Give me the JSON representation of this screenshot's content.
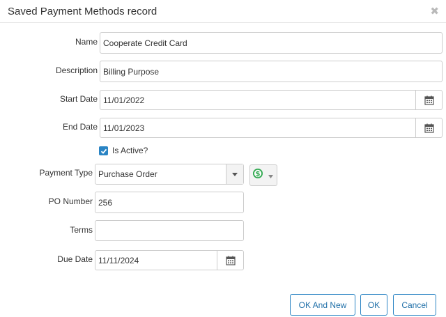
{
  "dialog": {
    "title": "Saved Payment Methods record"
  },
  "form": {
    "name": {
      "label": "Name",
      "value": "Cooperate Credit Card"
    },
    "description": {
      "label": "Description",
      "value": "Billing Purpose"
    },
    "start_date": {
      "label": "Start Date",
      "value": "11/01/2022"
    },
    "end_date": {
      "label": "End Date",
      "value": "11/01/2023"
    },
    "is_active": {
      "label": "Is Active?",
      "checked": true
    },
    "payment_type": {
      "label": "Payment Type",
      "value": "Purchase Order"
    },
    "po_number": {
      "label": "PO Number",
      "value": "256"
    },
    "terms": {
      "label": "Terms",
      "value": ""
    },
    "due_date": {
      "label": "Due Date",
      "value": "11/11/2024"
    }
  },
  "buttons": {
    "ok_and_new": "OK And New",
    "ok": "OK",
    "cancel": "Cancel"
  },
  "icons": {
    "close": "close-icon",
    "calendar": "calendar-icon",
    "payment": "dollar-coin-icon",
    "dropdown": "caret-down-icon"
  },
  "colors": {
    "accent": "#2a84c4",
    "payment_icon": "#2fa84f",
    "border": "#cccccc"
  }
}
